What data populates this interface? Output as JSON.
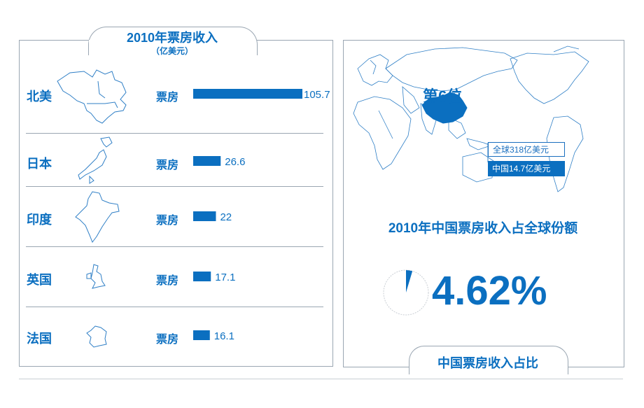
{
  "left": {
    "title": "2010年票房收入",
    "unit": "（亿美元）",
    "metric_label": "票房"
  },
  "right": {
    "rank": "第6位",
    "global_box": "全球318亿美元",
    "china_box": "中国14.7亿美元",
    "share_title": "2010年中国票房收入占全球份额",
    "share_value": "4.62%",
    "footer_title": "中国票房收入占比"
  },
  "colors": {
    "primary": "#0b6fc0",
    "border": "#9aa6b2",
    "map_stroke": "#2f7fc6"
  },
  "chart_data": [
    {
      "type": "bar",
      "orientation": "horizontal",
      "title": "2010年票房收入",
      "subtitle": "（亿美元）",
      "categories": [
        "北美",
        "日本",
        "印度",
        "英国",
        "法国"
      ],
      "series": [
        {
          "name": "票房",
          "values": [
            105.7,
            26.6,
            22,
            17.1,
            16.1
          ]
        }
      ],
      "value_labels": [
        "105.7",
        "26.6",
        "22",
        "17.1",
        "16.1"
      ],
      "grid": false
    },
    {
      "type": "pie",
      "title": "2010年中国票房收入占全球份额",
      "slices": [
        {
          "label": "中国",
          "value": 4.62
        },
        {
          "label": "",
          "value": 95.38
        }
      ]
    }
  ]
}
